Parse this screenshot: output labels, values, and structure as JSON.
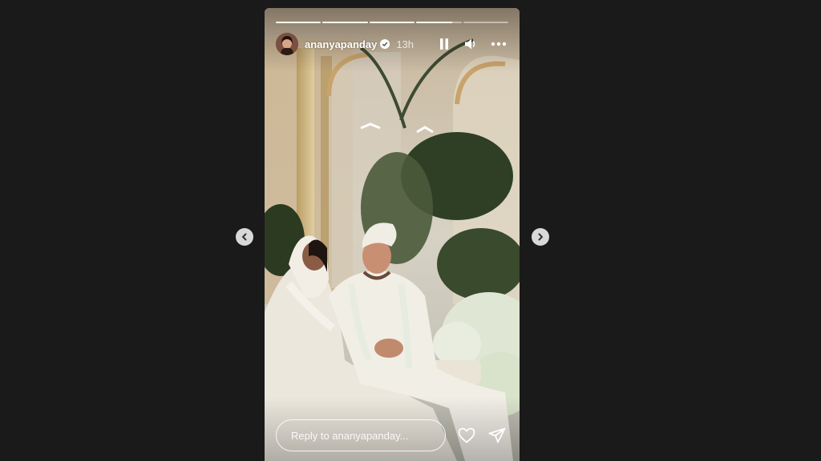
{
  "story": {
    "username": "ananyapanday",
    "verified": true,
    "time_ago": "13h",
    "progress_segments": [
      1,
      1,
      1,
      0.8,
      0
    ],
    "photo_description_icon": "wedding-photo"
  },
  "reply": {
    "placeholder": "Reply to ananyapanday..."
  },
  "icons": {
    "pause": "pause-icon",
    "sound": "speaker-icon",
    "more": "more-options-icon",
    "like": "heart-icon",
    "share": "send-icon",
    "prev": "chevron-left-icon",
    "next": "chevron-right-icon"
  },
  "colors": {
    "background": "#1a1a1a",
    "nav_button": "#d9d9d9"
  }
}
